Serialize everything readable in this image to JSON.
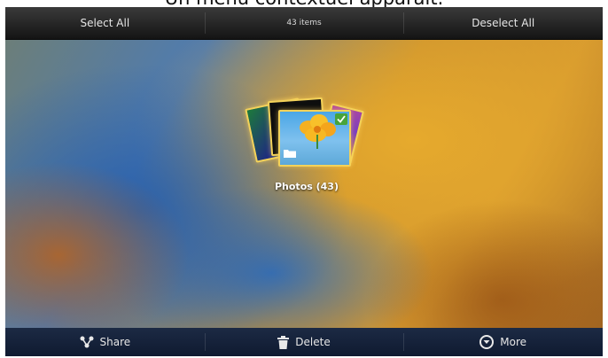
{
  "caption": "Un menu contextuel apparaît.",
  "action_bar": {
    "select_all": "Select All",
    "item_count": "43 items",
    "deselect_all": "Deselect All"
  },
  "album": {
    "label": "Photos  (43)",
    "selected": true,
    "icons": [
      "check-icon",
      "folder-icon"
    ]
  },
  "bottom_bar": {
    "share": {
      "label": "Share",
      "icon": "share-icon"
    },
    "delete": {
      "label": "Delete",
      "icon": "trash-icon"
    },
    "more": {
      "label": "More",
      "icon": "more-icon"
    }
  },
  "colors": {
    "highlight_border": "#f3d25a",
    "check_badge": "#47a43b",
    "bottom_bar": "#14213a"
  }
}
